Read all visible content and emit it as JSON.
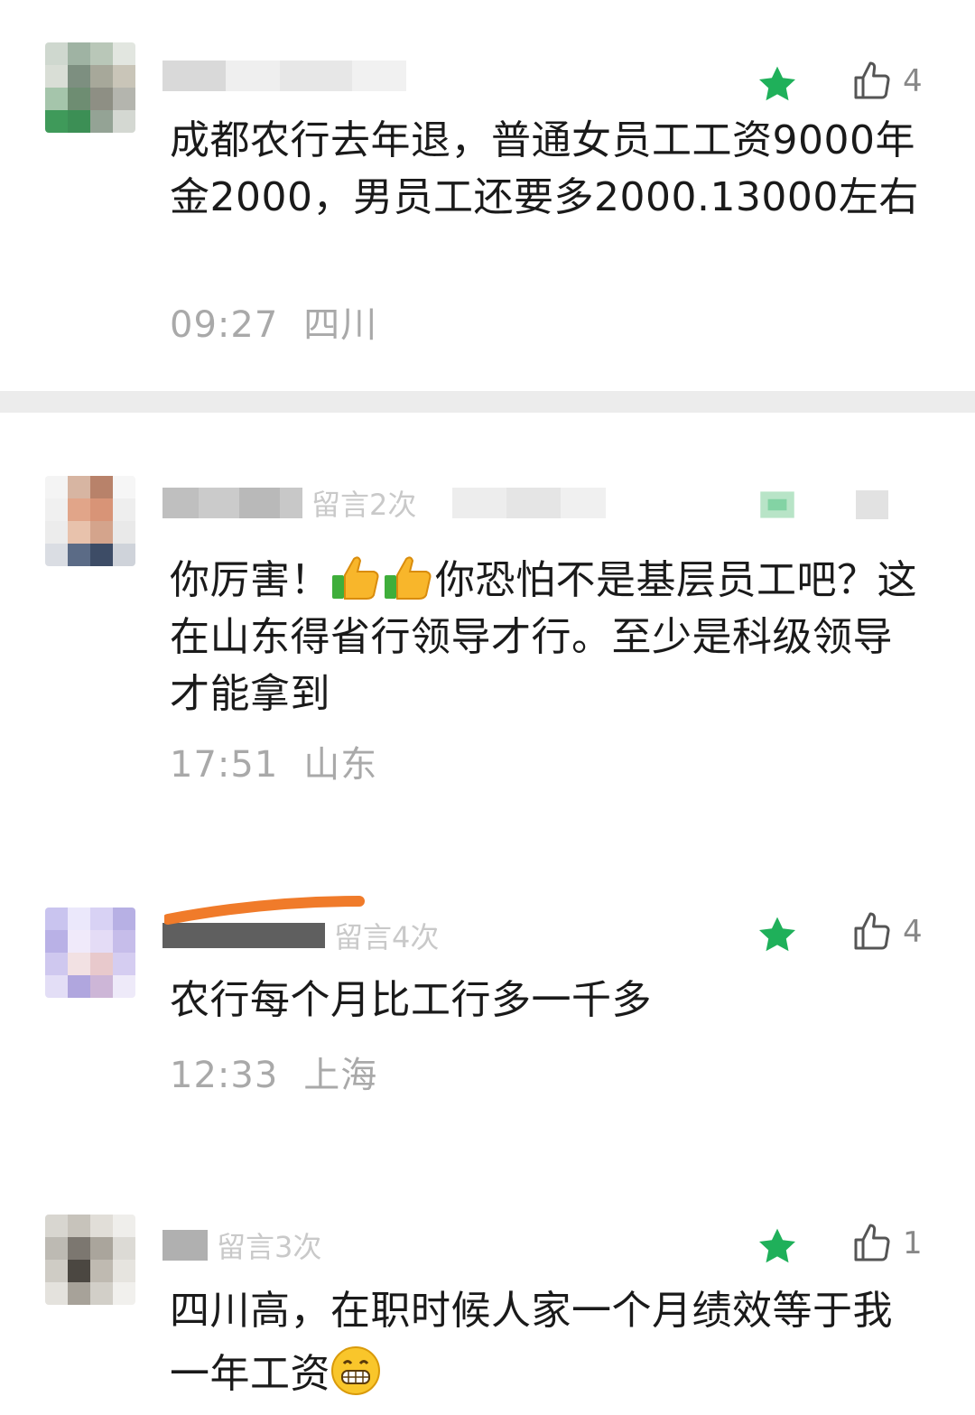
{
  "comments": [
    {
      "id": "c1",
      "meta_text": "",
      "likes": "4",
      "text": "成都农行去年退，普通女员工工资9000年金2000，男员工还要多2000.13000左右",
      "time": "09:27",
      "location": "四川"
    },
    {
      "id": "c2",
      "meta_text": "留言2次",
      "likes": "",
      "text_before": "你厉害！",
      "text_after": "你恐怕不是基层员工吧？这在山东得省行领导才行。至少是科级领导才能拿到",
      "time": "17:51",
      "location": "山东"
    },
    {
      "id": "c3",
      "meta_text": "留言4次",
      "likes": "4",
      "text": "农行每个月比工行多一千多",
      "time": "12:33",
      "location": "上海"
    },
    {
      "id": "c4",
      "meta_text": "留言3次",
      "likes": "1",
      "text": "四川高，在职时候人家一个月绩效等于我一年工资",
      "time": "",
      "location": ""
    }
  ],
  "icons": {
    "star": "star-icon",
    "like": "thumbs-up-outline-icon",
    "thumbs_emoji": "thumbs-up-emoji",
    "grin_emoji": "grinning-face-emoji"
  },
  "colors": {
    "star_green": "#1fb05a",
    "text": "#1a1a1a",
    "meta_gray": "#a9a9a9",
    "divider": "#ececec",
    "redaction_orange": "#f07b2a"
  }
}
